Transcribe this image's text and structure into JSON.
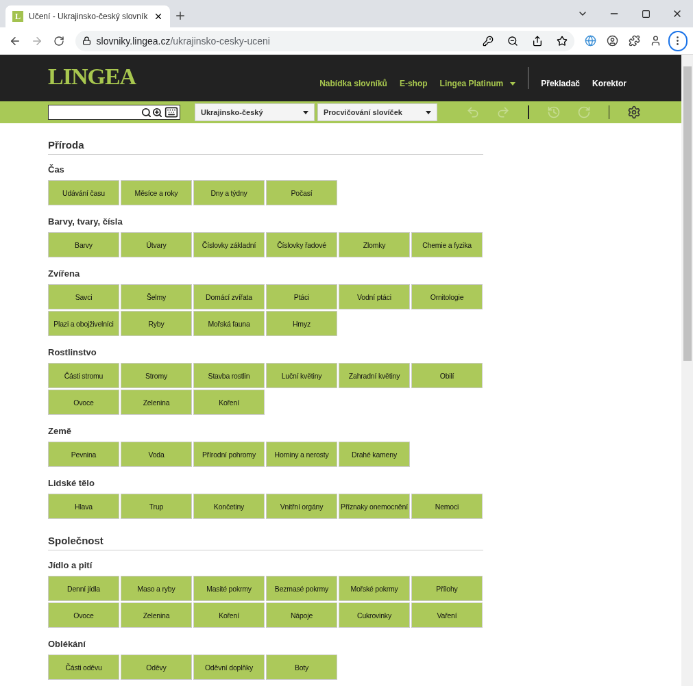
{
  "browser": {
    "favicon": "L",
    "tab_title": "Učení - Ukrajinsko-český slovník",
    "url_host": "slovniky.lingea.cz",
    "url_path": "/ukrajinsko-cesky-uceni"
  },
  "header": {
    "logo": "LINGEA",
    "nav": [
      {
        "label": "Nabídka slovníků",
        "dropdown": false
      },
      {
        "label": "E-shop",
        "dropdown": false
      },
      {
        "label": "Lingea Platinum",
        "dropdown": true
      }
    ],
    "tools": [
      "Překladač",
      "Korektor"
    ]
  },
  "toolbar": {
    "dictionary": "Ukrajinsko-český",
    "mode": "Procvičování slovíček",
    "actions": [
      {
        "kind": "undo",
        "disabled": true
      },
      {
        "kind": "redo",
        "disabled": true
      },
      {
        "kind": "separator"
      },
      {
        "kind": "history",
        "disabled": true
      },
      {
        "kind": "reload",
        "disabled": true
      },
      {
        "kind": "separator"
      },
      {
        "kind": "settings",
        "disabled": false
      }
    ]
  },
  "sections": [
    {
      "title": "Příroda",
      "groups": [
        {
          "title": "Čas",
          "items": [
            "Udávání času",
            "Měsíce a roky",
            "Dny a týdny",
            "Počasí"
          ]
        },
        {
          "title": "Barvy, tvary, čísla",
          "items": [
            "Barvy",
            "Útvary",
            "Číslovky základní",
            "Číslovky řadové",
            "Zlomky",
            "Chemie a fyzika"
          ]
        },
        {
          "title": "Zvířena",
          "items": [
            "Savci",
            "Šelmy",
            "Domácí zvířata",
            "Ptáci",
            "Vodní ptáci",
            "Ornitologie",
            "Plazi a obojživelníci",
            "Ryby",
            "Mořská fauna",
            "Hmyz"
          ]
        },
        {
          "title": "Rostlinstvo",
          "items": [
            "Části stromu",
            "Stromy",
            "Stavba rostlin",
            "Luční květiny",
            "Zahradní květiny",
            "Obilí",
            "Ovoce",
            "Zelenina",
            "Koření"
          ]
        },
        {
          "title": "Země",
          "items": [
            "Pevnina",
            "Voda",
            "Přírodní pohromy",
            "Horniny a nerosty",
            "Drahé kameny"
          ]
        },
        {
          "title": "Lidské tělo",
          "items": [
            "Hlava",
            "Trup",
            "Končetiny",
            "Vnitřní orgány",
            "Příznaky onemocnění",
            "Nemoci"
          ]
        }
      ]
    },
    {
      "title": "Společnost",
      "groups": [
        {
          "title": "Jídlo a pití",
          "items": [
            "Denní jídla",
            "Maso a ryby",
            "Masité pokrmy",
            "Bezmasé pokrmy",
            "Mořské pokrmy",
            "Přílohy",
            "Ovoce",
            "Zelenina",
            "Koření",
            "Nápoje",
            "Cukrovinky",
            "Vaření"
          ]
        },
        {
          "title": "Oblékání",
          "items": [
            "Části oděvu",
            "Oděvy",
            "Oděvní doplňky",
            "Boty"
          ]
        }
      ]
    }
  ]
}
